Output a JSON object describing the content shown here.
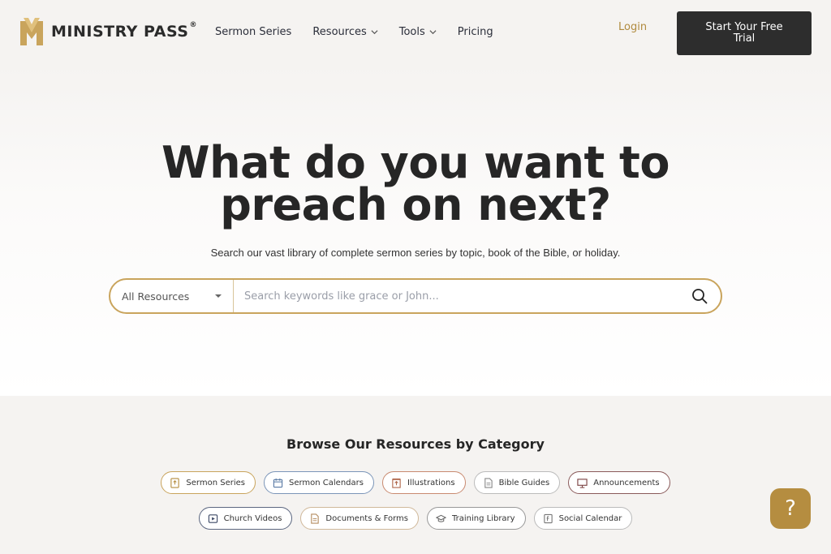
{
  "brand": {
    "name": "MINISTRY PASS",
    "reg_mark": "®",
    "color": "#c9a45c"
  },
  "nav": {
    "items": [
      {
        "label": "Sermon Series",
        "dropdown": false
      },
      {
        "label": "Resources",
        "dropdown": true
      },
      {
        "label": "Tools",
        "dropdown": true
      },
      {
        "label": "Pricing",
        "dropdown": false
      }
    ],
    "login_label": "Login",
    "trial_label": "Start Your Free Trial"
  },
  "hero": {
    "title_line1": "What do you want to",
    "title_line2": "preach on next?",
    "subtitle": "Search our vast library of complete sermon series by topic, book of the Bible, or holiday."
  },
  "search": {
    "category_value": "All Resources",
    "placeholder": "Search keywords like grace or John...",
    "value": ""
  },
  "categories": {
    "title": "Browse Our Resources by Category",
    "row1": [
      {
        "label": "Sermon Series",
        "icon": "sermon-series-icon",
        "border": "#c9a45c",
        "icon_color": "#b58d40"
      },
      {
        "label": "Sermon Calendars",
        "icon": "calendar-icon",
        "border": "#7b95b8",
        "icon_color": "#5a7aa5"
      },
      {
        "label": "Illustrations",
        "icon": "illustration-icon",
        "border": "#c98a70",
        "icon_color": "#b0664a"
      },
      {
        "label": "Bible Guides",
        "icon": "document-icon",
        "border": "#bbb",
        "icon_color": "#8a8a8a"
      },
      {
        "label": "Announcements",
        "icon": "presentation-icon",
        "border": "#8a5a5a",
        "icon_color": "#7a4040"
      }
    ],
    "row2": [
      {
        "label": "Church Videos",
        "icon": "video-icon",
        "border": "#5c6780",
        "icon_color": "#3e4a66"
      },
      {
        "label": "Documents & Forms",
        "icon": "document-icon",
        "border": "#d0b89a",
        "icon_color": "#b58d60"
      },
      {
        "label": "Training Library",
        "icon": "graduation-cap-icon",
        "border": "#999",
        "icon_color": "#666"
      },
      {
        "label": "Social Calendar",
        "icon": "social-calendar-icon",
        "border": "#bbb",
        "icon_color": "#777"
      }
    ]
  },
  "help": {
    "label": "?"
  }
}
